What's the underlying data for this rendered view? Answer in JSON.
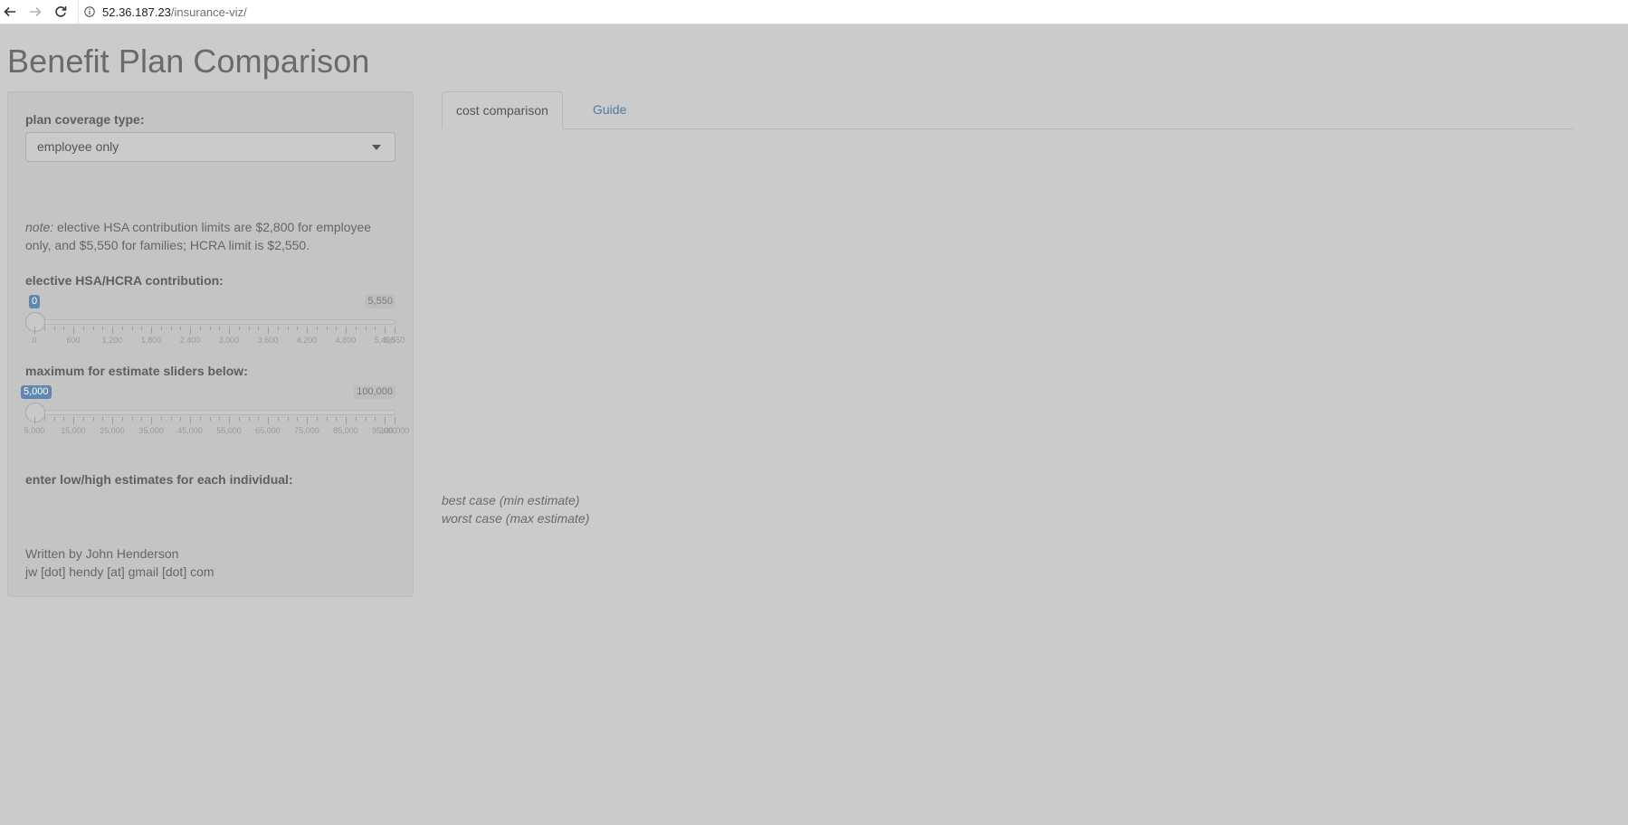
{
  "browser": {
    "host": "52.36.187.23",
    "path": "/insurance-viz/"
  },
  "page": {
    "title": "Benefit Plan Comparison"
  },
  "sidebar": {
    "coverage_label": "plan coverage type:",
    "coverage_value": "employee only",
    "note_prefix": "note:",
    "note_text": " elective HSA contribution limits are $2,800 for employee only, and $5,550 for families; HCRA limit is $2,550.",
    "hsa_label": "elective HSA/HCRA contribution:",
    "hsa_slider": {
      "value": "0",
      "max": "5,550",
      "ticks": [
        "0",
        "600",
        "1,200",
        "1,800",
        "2,400",
        "3,000",
        "3,600",
        "4,200",
        "4,800",
        "5,400",
        "5,550"
      ]
    },
    "max_label": "maximum for estimate sliders below:",
    "max_slider": {
      "value": "5,000",
      "max": "100,000",
      "ticks": [
        "5,000",
        "15,000",
        "25,000",
        "35,000",
        "45,000",
        "55,000",
        "65,000",
        "75,000",
        "85,000",
        "95,000",
        "100,000"
      ]
    },
    "estimates_label": "enter low/high estimates for each individual:",
    "credit_line1": "Written by John Henderson",
    "credit_line2": "jw [dot] hendy [at] gmail [dot] com"
  },
  "tabs": [
    {
      "label": "cost comparison",
      "active": true
    },
    {
      "label": "Guide",
      "active": false
    }
  ],
  "legend": {
    "best": "best case (min estimate)",
    "worst": "worst case (max estimate)"
  },
  "colors": {
    "background": "#cbcbcb",
    "accent": "#5f87b0",
    "link": "#4f7aa3"
  }
}
